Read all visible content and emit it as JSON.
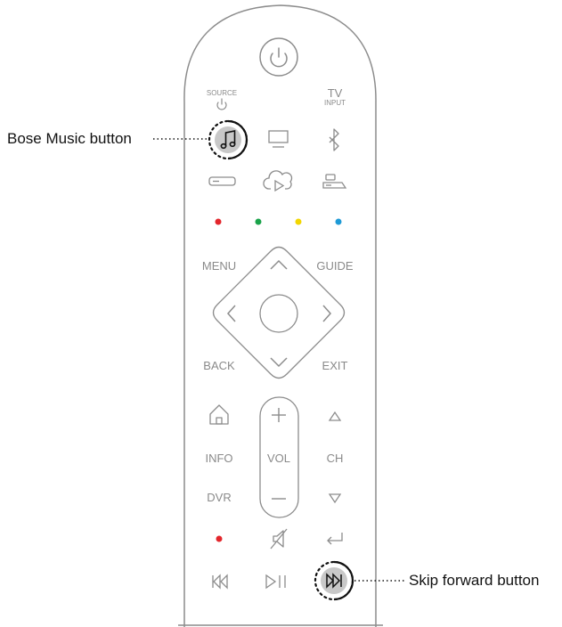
{
  "callouts": {
    "music_button": "Bose Music button",
    "skip_forward": "Skip forward button"
  },
  "labels": {
    "source": "SOURCE",
    "tv": "TV",
    "input": "INPUT",
    "menu": "MENU",
    "guide": "GUIDE",
    "back": "BACK",
    "exit": "EXIT",
    "info": "INFO",
    "vol": "VOL",
    "ch": "CH",
    "dvr": "DVR"
  },
  "colors": {
    "outline": "#8c8c8c",
    "highlight": "#c8c8c8",
    "red": "#e3262c",
    "green": "#1aa34a",
    "yellow": "#f2d600",
    "blue": "#1e9ad6"
  },
  "icons": [
    "power-icon",
    "music-note-icon",
    "tv-icon",
    "bluetooth-icon",
    "soundbar-icon",
    "cloud-play-icon",
    "game-console-icon",
    "home-icon",
    "mute-icon",
    "return-icon",
    "skip-back-icon",
    "play-pause-icon",
    "skip-forward-icon"
  ]
}
